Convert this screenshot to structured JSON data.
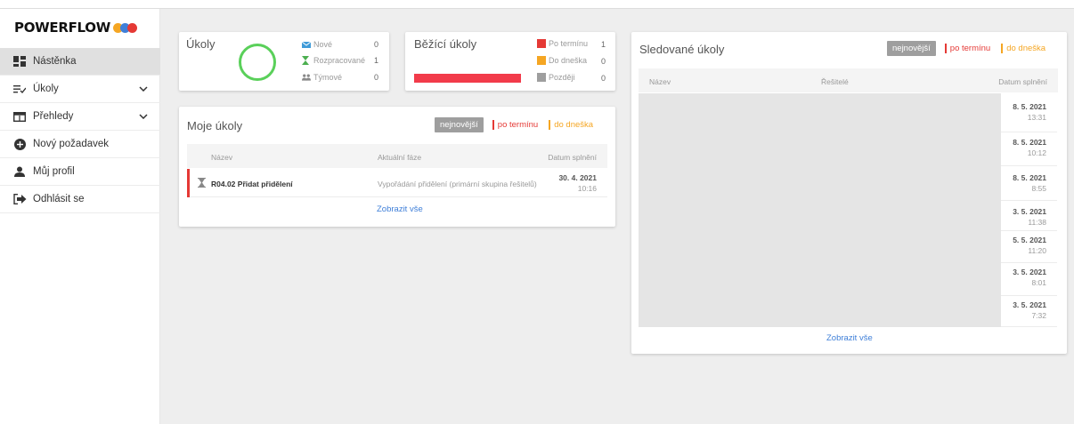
{
  "app": {
    "logo_text": "POWERFLOW",
    "logo_colors": [
      "#f5a623",
      "#3f7fd8",
      "#e53935"
    ]
  },
  "sidebar": {
    "items": [
      {
        "label": "Nástěnka",
        "icon": "dashboard-icon"
      },
      {
        "label": "Úkoly",
        "icon": "tasks-list-icon"
      },
      {
        "label": "Přehledy",
        "icon": "overview-table-icon"
      },
      {
        "label": "Nový požadavek",
        "icon": "plus-circle-icon"
      },
      {
        "label": "Můj profil",
        "icon": "user-icon"
      },
      {
        "label": "Odhlásit se",
        "icon": "logout-icon"
      }
    ]
  },
  "ukoly_card": {
    "title": "Úkoly",
    "stats": [
      {
        "label": "Nové",
        "value": "0",
        "icon": "envelope-icon"
      },
      {
        "label": "Rozpracované",
        "value": "1",
        "icon": "hourglass-icon"
      },
      {
        "label": "Týmové",
        "value": "0",
        "icon": "team-icon"
      }
    ]
  },
  "bezici_card": {
    "title": "Běžící úkoly",
    "stats": [
      {
        "label": "Po termínu",
        "value": "1",
        "color": "#e53935"
      },
      {
        "label": "Do dneška",
        "value": "0",
        "color": "#f5a623"
      },
      {
        "label": "Později",
        "value": "0",
        "color": "#9e9e9e"
      }
    ],
    "overdue_fraction": 1.0
  },
  "moje_ukoly": {
    "title": "Moje úkoly",
    "filters": {
      "newest": "nejnovější",
      "overdue": "po termínu",
      "today": "do dneška"
    },
    "columns": {
      "name": "Název",
      "phase": "Aktuální fáze",
      "due": "Datum splnění"
    },
    "rows": [
      {
        "name": "R04.02 Přidat přidělení",
        "phase": "Vypořádání přidělení (primární skupina řešitelů)",
        "date": "30. 4. 2021",
        "time": "10:16"
      }
    ],
    "show_all": "Zobrazit vše"
  },
  "sledovane_ukoly": {
    "title": "Sledované úkoly",
    "filters": {
      "newest": "nejnovější",
      "overdue": "po termínu",
      "today": "do dneška"
    },
    "columns": {
      "name": "Název",
      "solvers": "Řešitelé",
      "due": "Datum splnění"
    },
    "rows": [
      {
        "date": "8. 5. 2021",
        "time": "13:31"
      },
      {
        "date": "8. 5. 2021",
        "time": "10:12"
      },
      {
        "date": "8. 5. 2021",
        "time": "8:55"
      },
      {
        "date": "3. 5. 2021",
        "time": "11:38"
      },
      {
        "date": "5. 5. 2021",
        "time": "11:20"
      },
      {
        "date": "3. 5. 2021",
        "time": "8:01"
      },
      {
        "date": "3. 5. 2021",
        "time": "7:32"
      }
    ],
    "show_all": "Zobrazit vše"
  }
}
